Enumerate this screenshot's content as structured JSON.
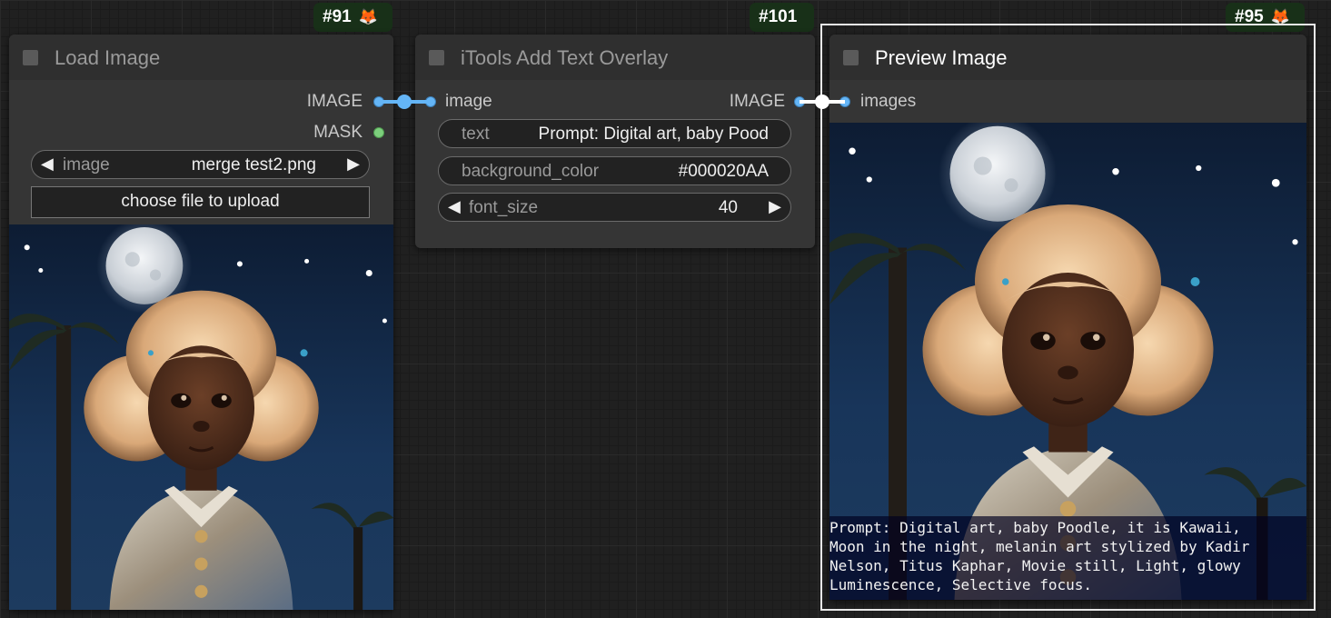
{
  "nodes": {
    "load_image": {
      "badge": "#91",
      "title": "Load Image",
      "outputs": [
        "IMAGE",
        "MASK"
      ],
      "image_widget": {
        "label": "image",
        "value": "merge test2.png"
      },
      "upload_label": "choose file to upload"
    },
    "text_overlay": {
      "badge": "#101",
      "title": "iTools Add Text Overlay",
      "input": "image",
      "output": "IMAGE",
      "widgets": {
        "text": {
          "label": "text",
          "value": "Prompt: Digital art, baby Pood"
        },
        "background_color": {
          "label": "background_color",
          "value": "#000020AA"
        },
        "font_size": {
          "label": "font_size",
          "value": "40"
        }
      }
    },
    "preview_image": {
      "badge": "#95",
      "title": "Preview Image",
      "input": "images",
      "overlay_lines": [
        "Prompt: Digital art, baby Poodle, it is Kawaii,",
        "Moon in the night, melanin art stylized by Kadir",
        "Nelson, Titus Kaphar, Movie still, Light, glowy",
        "Luminescence, Selective focus."
      ]
    }
  },
  "icons": {
    "badge_icon": "fox-icon",
    "arrow_left": "arrow-left-icon",
    "arrow_right": "arrow-right-icon"
  },
  "colors": {
    "canvas": "#202020",
    "node_body": "#353535",
    "node_header": "#2f2f2f",
    "badge_bg": "#183018",
    "image_link": "#64b5f6",
    "mask_link": "#7ccf7c",
    "selection": "#e8e8e8"
  }
}
